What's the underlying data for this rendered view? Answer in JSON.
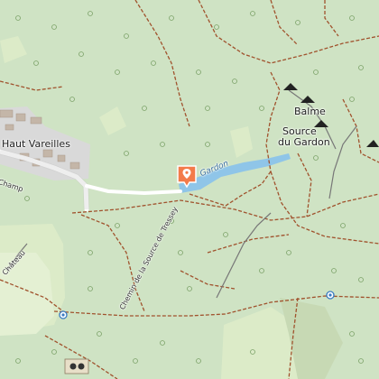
{
  "map": {
    "places": {
      "village": "Haut Vareilles",
      "peak": "Balme",
      "spring_line1": "Source",
      "spring_line2": "du Gardon"
    },
    "roads": {
      "champ": "Champ",
      "chemin": "Chemin de la Source de Tressey",
      "chateau": "Château"
    },
    "water": {
      "river": "Gardon"
    },
    "colors": {
      "background": "#cfe3c4",
      "meadow": "#dcebc8",
      "field": "#e4f0d3",
      "water": "#8fc5e8",
      "road": "#ffffff",
      "track": "#a0522d",
      "marker": "#f37b4a",
      "urban": "#d9d9d9"
    },
    "icons": {
      "location_marker": "map-pin-icon",
      "peak": "peak-triangle-icon",
      "spring": "spring-circle-icon",
      "viewpoint": "binoculars-icon"
    }
  }
}
